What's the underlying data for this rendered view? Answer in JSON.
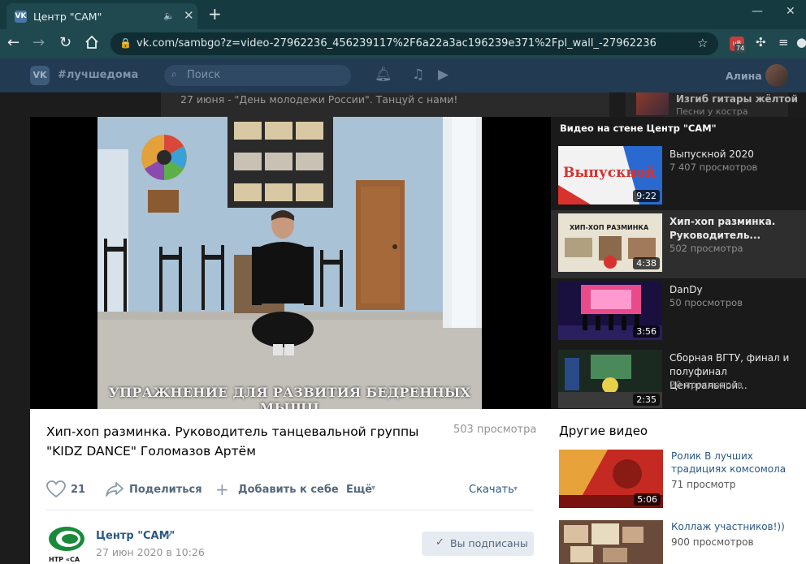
{
  "browser": {
    "tab_title": "Центр \"САМ\"",
    "tab_favicon": "VK",
    "url": "vk.com/sambgo?z=video-27962236_456239117%2F6a22a3ac196239e371%2Fpl_wall_-27962236",
    "extension_badge": "74",
    "extension_label": "uB"
  },
  "vk_header": {
    "logo": "VK",
    "hashtag": "#лучшедома",
    "search_placeholder": "Поиск",
    "user_name": "Алина"
  },
  "background": {
    "post_text": "27 июня - \"День молодежи России\". Танцуй с нами!",
    "side_title": "Изгиб гитары жёлтой",
    "side_sub": "Песни у костра"
  },
  "video": {
    "caption": "УПРАЖНЕНИЕ ДЛЯ РАЗВИТИЯ БЕДРЕННЫХ МЫШЦ",
    "title": "Хип-хоп разминка. Руководитель танцевальной группы \"KIDZ DANCE\" Голомазов Артём",
    "views": "503 просмотра",
    "likes": "21",
    "share_label": "Поделиться",
    "add_label": "Добавить к себе",
    "more_label": "Ещё",
    "download_label": "Скачать"
  },
  "owner": {
    "name": "Центр \"САМ\"",
    "date": "27 июн 2020 в 10:26",
    "subscribed_label": "Вы подписаны",
    "logo_text": "НТР «СА"
  },
  "playlist": {
    "title": "Видео на стене Центр \"САМ\"",
    "items": [
      {
        "name": "Выпускной 2020",
        "views": "7 407 просмотров",
        "duration": "9:22",
        "thumb_text": "Выпускной"
      },
      {
        "name": "Хип-хоп разминка. Руководитель...",
        "views": "502 просмотра",
        "duration": "4:38",
        "thumb_text": "ХИП-ХОП РАЗМИНКА"
      },
      {
        "name": "DanDy",
        "views": "50 просмотров",
        "duration": "3:56"
      },
      {
        "name": "Сборная ВГТУ, финал и полуфинал Центральной...",
        "views": "20 просмотров",
        "duration": "2:35"
      }
    ]
  },
  "other_videos": {
    "title": "Другие видео",
    "items": [
      {
        "name": "Ролик В лучших традициях комсомола",
        "views": "71 просмотр",
        "duration": "5:06"
      },
      {
        "name": "Коллаж участников!))",
        "views": "900 просмотров"
      }
    ]
  }
}
